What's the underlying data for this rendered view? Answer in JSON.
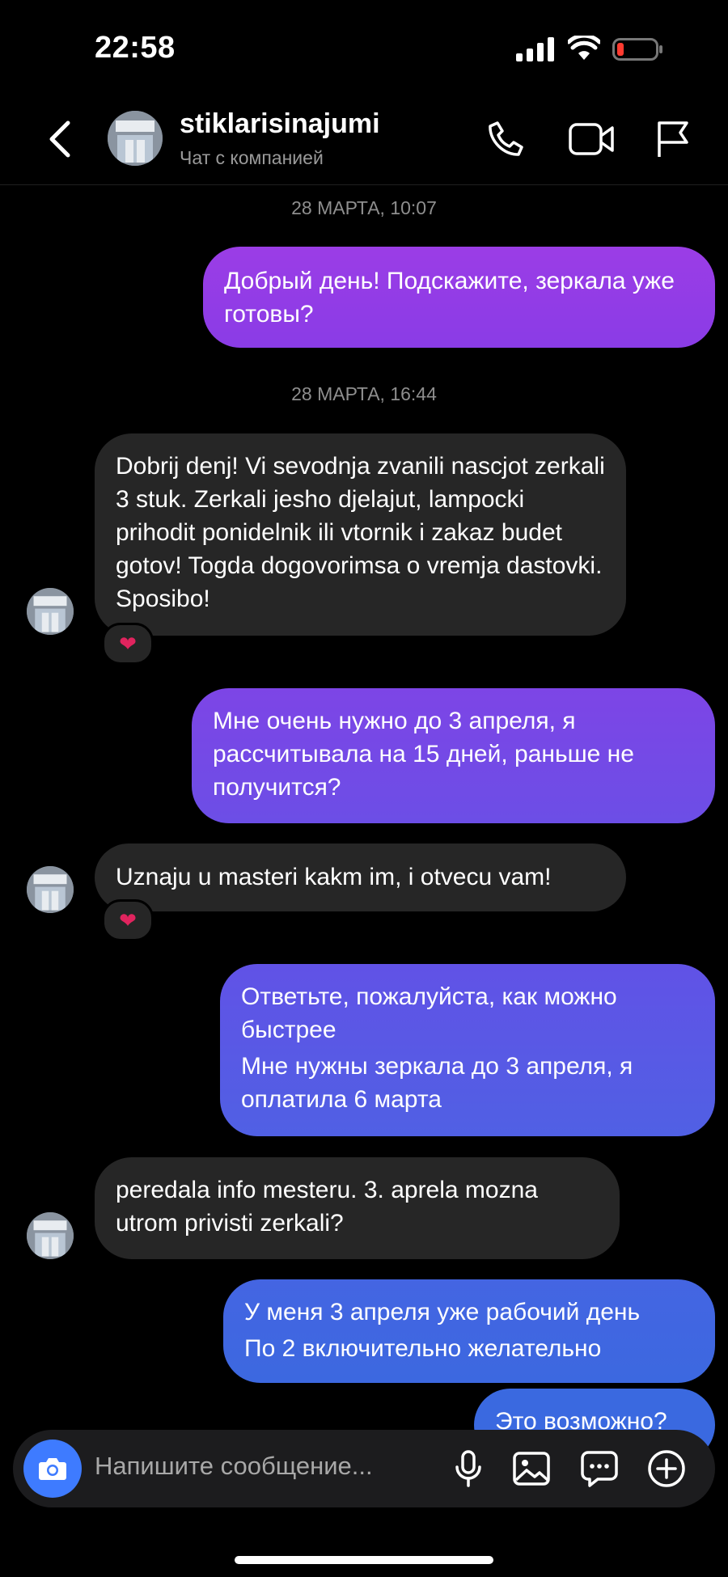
{
  "status": {
    "time": "22:58"
  },
  "header": {
    "name": "stiklarisinajumi",
    "subtitle": "Чат с компанией"
  },
  "messages": [
    {
      "kind": "timestamp",
      "text": "28 МАРТА, 10:07"
    },
    {
      "kind": "out",
      "lines": [
        "Добрый день! Подскажите, зеркала уже готовы?"
      ]
    },
    {
      "kind": "timestamp",
      "text": "28 МАРТА, 16:44"
    },
    {
      "kind": "in",
      "lines": [
        "Dobrij denj! Vi sevodnja zvanili nascjot zerkali 3 stuk. Zerkali jesho djelajut, lampocki prihodit ponidelnik ili vtornik i zakaz budet gotov! Togda dogovorimsa o vremja dastovki. Sposibo!"
      ],
      "reaction": "❤"
    },
    {
      "kind": "out",
      "lines": [
        "Мне очень нужно до 3 апреля, я рассчитывала на 15 дней, раньше не получится?"
      ]
    },
    {
      "kind": "in",
      "lines": [
        "Uznaju u masteri kakm im, i otvecu vam!"
      ],
      "reaction": "❤"
    },
    {
      "kind": "out",
      "lines": [
        "Ответьте, пожалуйста, как можно быстрее",
        "Мне нужны зеркала до 3 апреля, я оплатила 6 марта"
      ]
    },
    {
      "kind": "in",
      "lines": [
        "peredala info mesteru. 3. aprela mozna utrom privisti zerkali?"
      ]
    },
    {
      "kind": "out",
      "lines": [
        "У меня 3 апреля уже рабочий день",
        "По 2 включительно желательно"
      ]
    },
    {
      "kind": "out",
      "lines": [
        "Это возможно?"
      ]
    }
  ],
  "composer": {
    "placeholder": "Напишите сообщение..."
  },
  "colors": {
    "out_top": "#9b3de6",
    "out_bottom": "#3a67e0",
    "incoming": "#262626",
    "camera": "#3e7bff"
  }
}
